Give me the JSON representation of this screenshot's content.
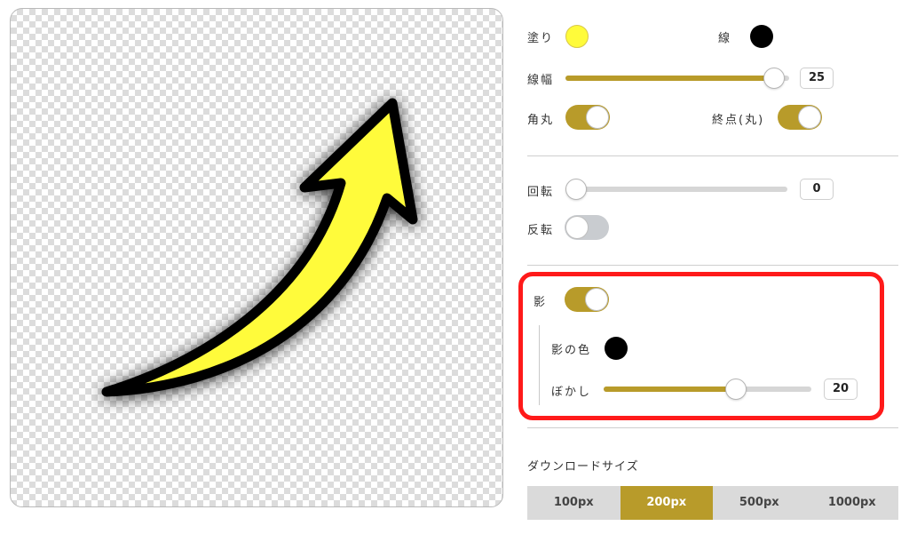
{
  "colors": {
    "accent": "#b89b2a",
    "fill": "#fffb3a",
    "stroke": "#000000",
    "shadow": "#000000",
    "highlight": "#ff1a1a"
  },
  "style": {
    "fill_label": "塗り",
    "stroke_label": "線",
    "stroke_width_label": "線幅",
    "stroke_width_value": "25",
    "stroke_width_level": 0.98,
    "round_label": "角丸",
    "round_on": true,
    "endpoint_label": "終点(丸)",
    "endpoint_on": true
  },
  "transform": {
    "rotate_label": "回転",
    "rotate_value": "0",
    "rotate_level": 0.0,
    "flip_label": "反転",
    "flip_on": false
  },
  "shadow": {
    "label": "影",
    "on": true,
    "color_label": "影の色",
    "blur_label": "ぼかし",
    "blur_value": "20",
    "blur_level": 0.65
  },
  "download": {
    "label": "ダウンロードサイズ",
    "sizes": [
      "100px",
      "200px",
      "500px",
      "1000px"
    ],
    "selected": "200px"
  },
  "canvas": {
    "shape_icon": "curved-arrow-icon"
  }
}
